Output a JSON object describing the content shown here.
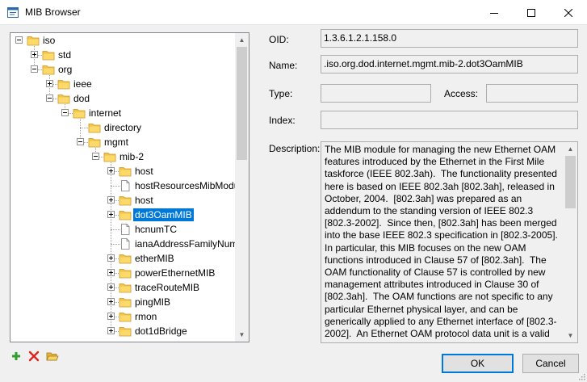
{
  "window": {
    "title": "MIB Browser",
    "minimize_icon": "minimize-icon",
    "maximize_icon": "maximize-icon",
    "close_icon": "close-icon"
  },
  "tree": {
    "folder_color": "#f5c542",
    "selected_color": "#0078d7",
    "nodes": [
      {
        "label": "iso",
        "depth": 0,
        "expander": "minus",
        "icon": "folder"
      },
      {
        "label": "std",
        "depth": 1,
        "expander": "plus",
        "icon": "folder"
      },
      {
        "label": "org",
        "depth": 1,
        "expander": "minus",
        "icon": "folder"
      },
      {
        "label": "ieee",
        "depth": 2,
        "expander": "plus",
        "icon": "folder"
      },
      {
        "label": "dod",
        "depth": 2,
        "expander": "minus",
        "icon": "folder"
      },
      {
        "label": "internet",
        "depth": 3,
        "expander": "minus",
        "icon": "folder"
      },
      {
        "label": "directory",
        "depth": 4,
        "expander": "none",
        "icon": "folder"
      },
      {
        "label": "mgmt",
        "depth": 4,
        "expander": "minus",
        "icon": "folder"
      },
      {
        "label": "mib-2",
        "depth": 5,
        "expander": "minus",
        "icon": "folder"
      },
      {
        "label": "host",
        "depth": 6,
        "expander": "plus",
        "icon": "folder"
      },
      {
        "label": "hostResourcesMibModu",
        "depth": 6,
        "expander": "none",
        "icon": "document"
      },
      {
        "label": "host",
        "depth": 6,
        "expander": "plus",
        "icon": "folder"
      },
      {
        "label": "dot3OamMIB",
        "depth": 6,
        "expander": "plus",
        "icon": "folder",
        "selected": true
      },
      {
        "label": "hcnumTC",
        "depth": 6,
        "expander": "none",
        "icon": "document"
      },
      {
        "label": "ianaAddressFamilyNum",
        "depth": 6,
        "expander": "none",
        "icon": "document"
      },
      {
        "label": "etherMIB",
        "depth": 6,
        "expander": "plus",
        "icon": "folder"
      },
      {
        "label": "powerEthernetMIB",
        "depth": 6,
        "expander": "plus",
        "icon": "folder"
      },
      {
        "label": "traceRouteMIB",
        "depth": 6,
        "expander": "plus",
        "icon": "folder"
      },
      {
        "label": "pingMIB",
        "depth": 6,
        "expander": "plus",
        "icon": "folder"
      },
      {
        "label": "rmon",
        "depth": 6,
        "expander": "plus",
        "icon": "folder"
      },
      {
        "label": "dot1dBridge",
        "depth": 6,
        "expander": "plus",
        "icon": "folder"
      }
    ]
  },
  "details": {
    "oid_label": "OID:",
    "oid_value": "1.3.6.1.2.1.158.0",
    "name_label": "Name:",
    "name_value": ".iso.org.dod.internet.mgmt.mib-2.dot3OamMIB",
    "type_label": "Type:",
    "type_value": "",
    "access_label": "Access:",
    "access_value": "",
    "index_label": "Index:",
    "index_value": "",
    "description_label": "Description:",
    "description_value": "The MIB module for managing the new Ethernet OAM features introduced by the Ethernet in the First Mile taskforce (IEEE 802.3ah).  The functionality presented here is based on IEEE 802.3ah [802.3ah], released in October, 2004.  [802.3ah] was prepared as an addendum to the standing version of IEEE 802.3 [802.3-2002].  Since then, [802.3ah] has been merged into the base IEEE 802.3 specification in [802.3-2005].  In particular, this MIB focuses on the new OAM functions introduced in Clause 57 of [802.3ah].  The OAM functionality of Clause 57 is controlled by new management attributes introduced in Clause 30 of [802.3ah].  The OAM functions are not specific to any particular Ethernet physical layer, and can be generically applied to any Ethernet interface of [802.3-2002].  An Ethernet OAM protocol data unit is a valid"
  },
  "toolbar": {
    "add_icon": "add-icon",
    "delete_icon": "delete-icon",
    "open_folder_icon": "open-folder-icon"
  },
  "buttons": {
    "ok_label": "OK",
    "cancel_label": "Cancel"
  }
}
